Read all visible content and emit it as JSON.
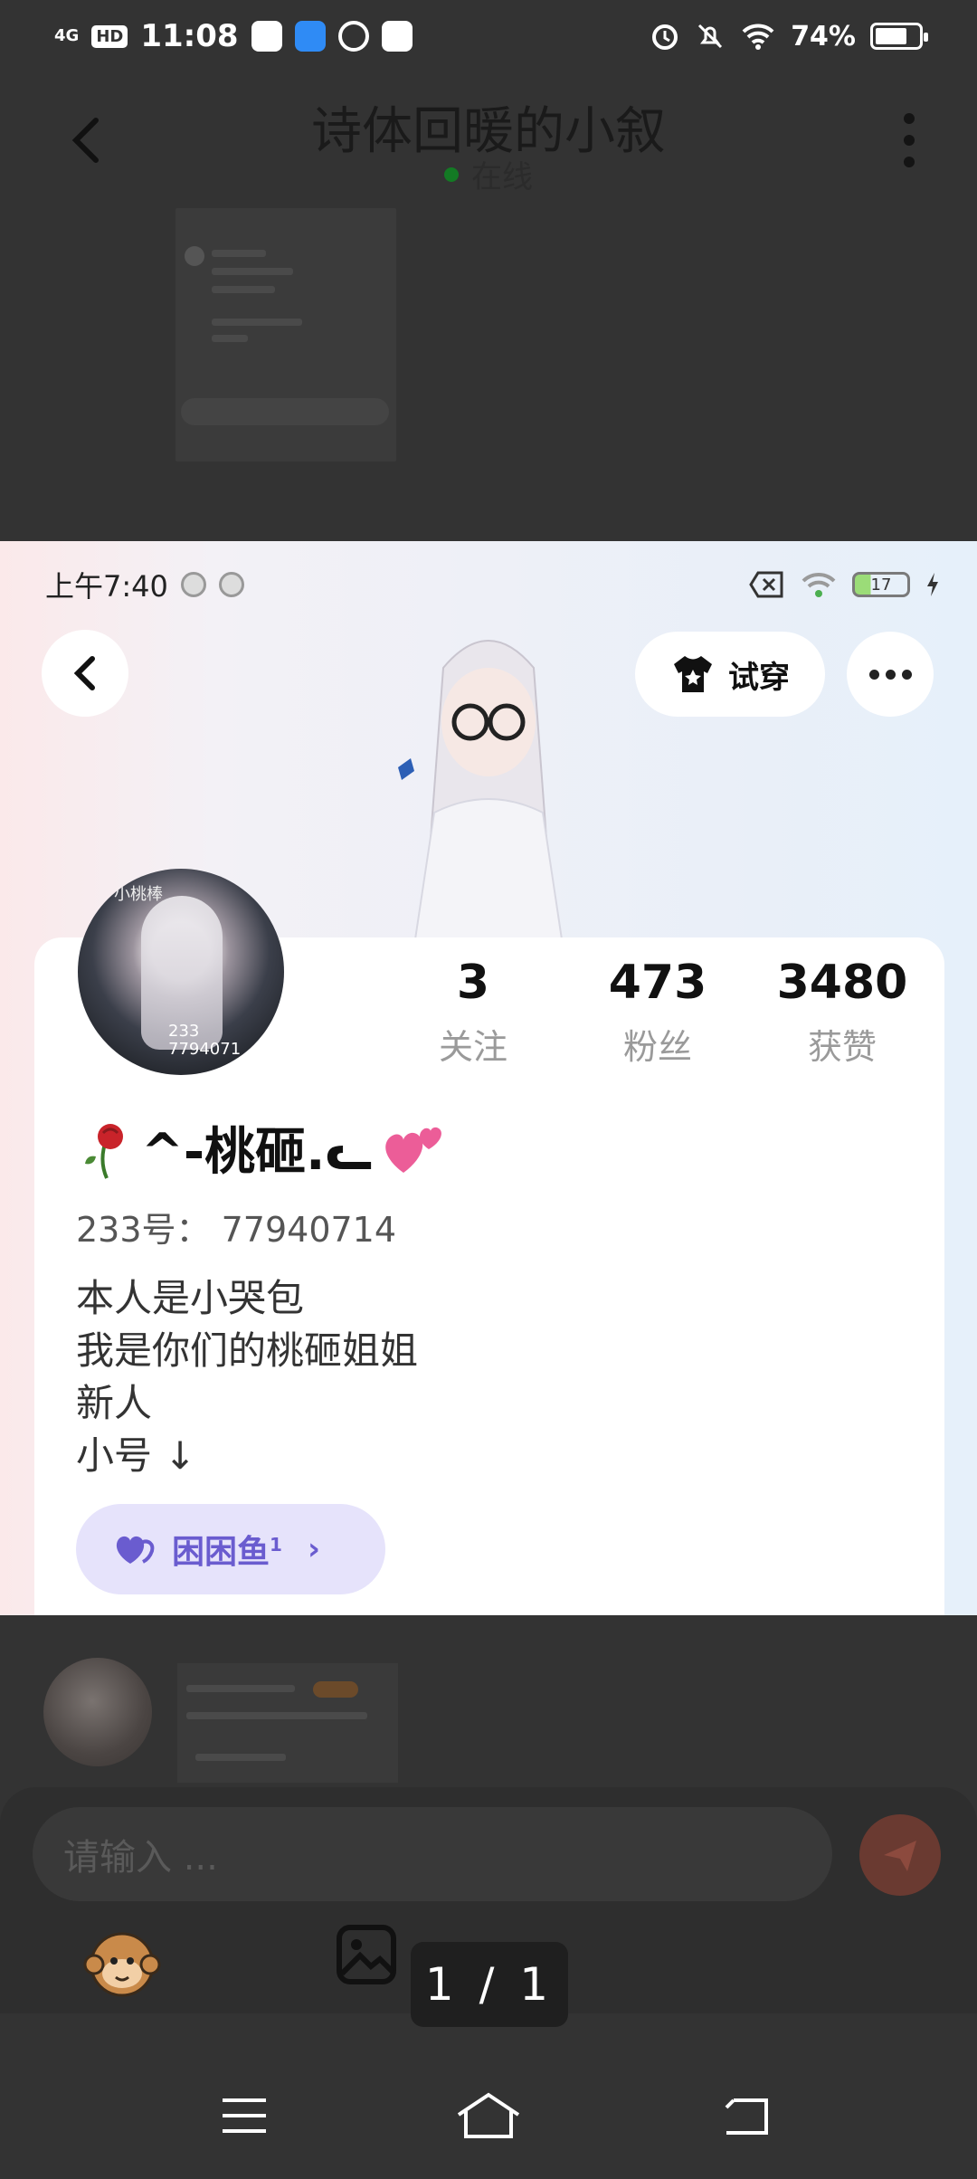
{
  "status_bar": {
    "network": "4G",
    "hd": "HD",
    "time": "11:08",
    "battery": "74%",
    "battery_level": 0.74
  },
  "chat": {
    "title": "诗体回暖的小叙",
    "status": "在线"
  },
  "input": {
    "placeholder": "请输入 ..."
  },
  "viewer": {
    "page_counter": "1 / 1"
  },
  "screenshot": {
    "status": {
      "time": "上午7:40",
      "battery": "17",
      "battery_level": 0.17
    },
    "try_on_label": "试穿",
    "profile": {
      "nickname": "^-桃砸.ᓚ",
      "uid_line": "233号： 77940714",
      "bio": [
        "本人是小哭包",
        "我是你们的桃砸姐姐",
        "新人",
        "小号 ↓"
      ],
      "avatar_text_top": "小桃棒",
      "avatar_text_bottom": "233\n7794071",
      "stats": [
        {
          "value": "3",
          "label": "关注"
        },
        {
          "value": "473",
          "label": "粉丝"
        },
        {
          "value": "3480",
          "label": "获赞"
        }
      ],
      "fan_club": {
        "label": "困困鱼",
        "level": "1"
      }
    }
  },
  "colors": {
    "accent_purple": "#6a5ccf",
    "pill_bg": "#e6e3fb",
    "online_green": "#137a24"
  }
}
